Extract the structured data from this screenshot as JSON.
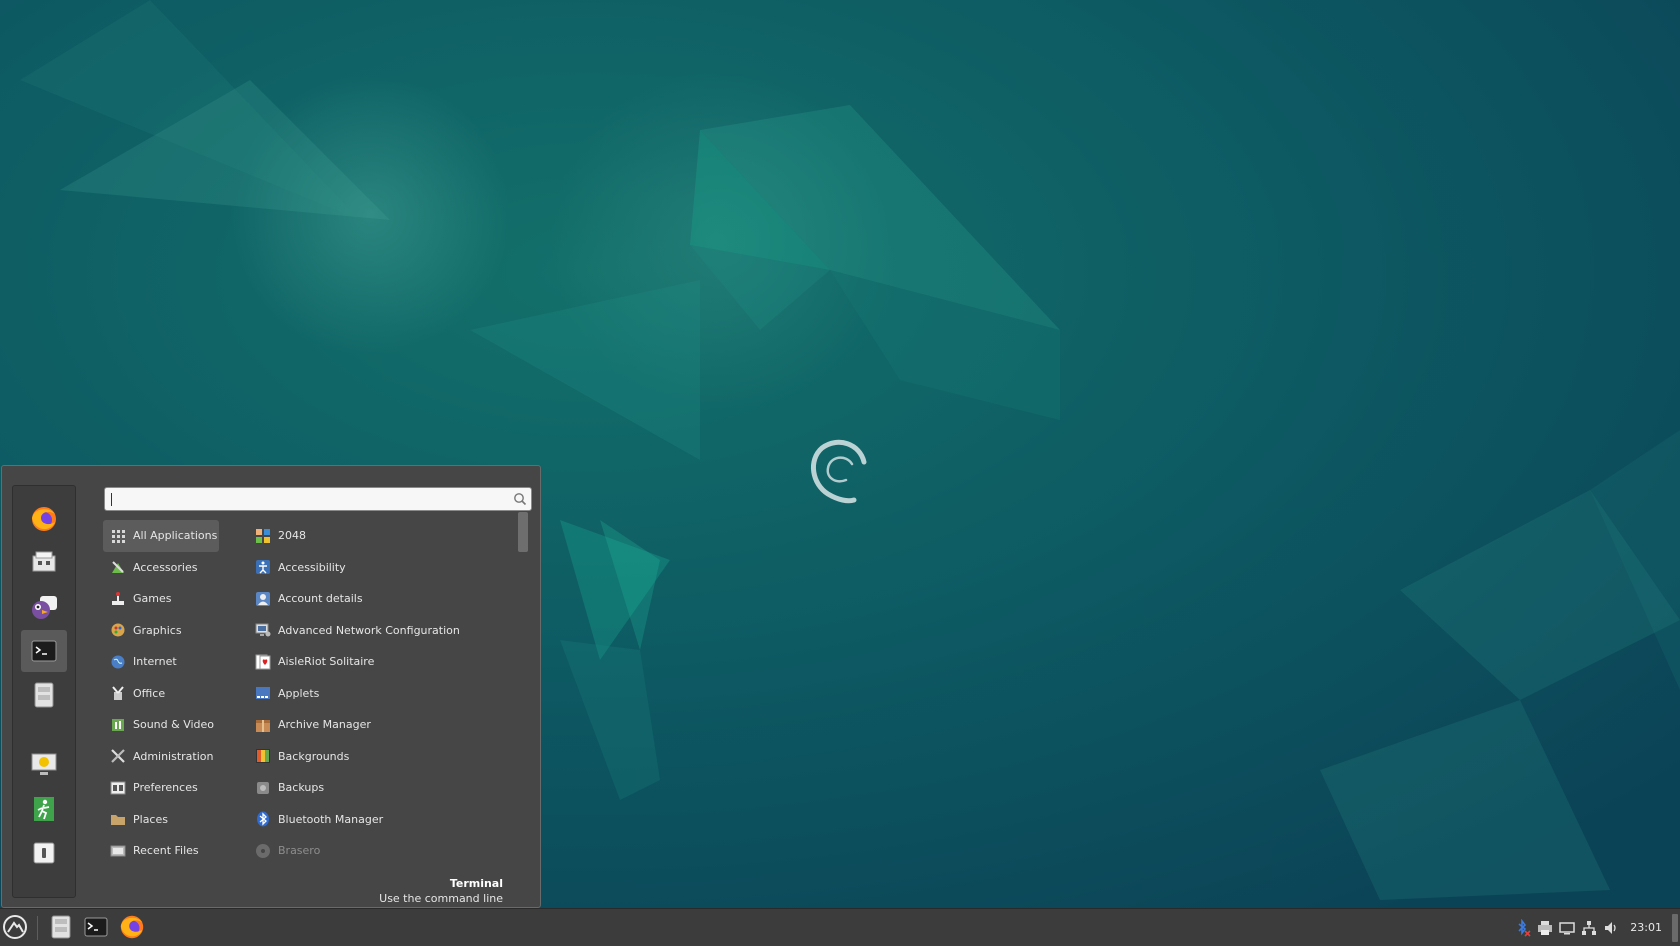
{
  "colors": {
    "accent": "#0d7c6e",
    "menu_bg": "#464646",
    "panel_bg": "#3c3c3c",
    "dim_text": "#8d8d8d"
  },
  "favorites": [
    {
      "icon": "firefox-icon"
    },
    {
      "icon": "software-manager-icon"
    },
    {
      "icon": "pidgin-icon"
    },
    {
      "icon": "terminal-icon",
      "active": true
    },
    {
      "icon": "file-manager-icon"
    },
    {
      "icon": "lock-screen-icon"
    },
    {
      "icon": "logout-icon"
    },
    {
      "icon": "shutdown-icon"
    }
  ],
  "search": {
    "placeholder": "",
    "value": ""
  },
  "categories": [
    {
      "label": "All Applications",
      "icon": "grid-icon"
    },
    {
      "label": "Accessories",
      "icon": "accessories-icon"
    },
    {
      "label": "Games",
      "icon": "games-icon"
    },
    {
      "label": "Graphics",
      "icon": "graphics-icon"
    },
    {
      "label": "Internet",
      "icon": "internet-icon"
    },
    {
      "label": "Office",
      "icon": "office-icon"
    },
    {
      "label": "Sound & Video",
      "icon": "sound-video-icon"
    },
    {
      "label": "Administration",
      "icon": "administration-icon"
    },
    {
      "label": "Preferences",
      "icon": "preferences-icon"
    },
    {
      "label": "Places",
      "icon": "folder-icon"
    },
    {
      "label": "Recent Files",
      "icon": "recent-files-icon"
    }
  ],
  "apps": [
    {
      "label": "2048",
      "icon": "game-2048-icon"
    },
    {
      "label": "Accessibility",
      "icon": "accessibility-icon"
    },
    {
      "label": "Account details",
      "icon": "account-icon"
    },
    {
      "label": "Advanced Network Configuration",
      "icon": "network-config-icon"
    },
    {
      "label": "AisleRiot Solitaire",
      "icon": "solitaire-icon"
    },
    {
      "label": "Applets",
      "icon": "applets-icon"
    },
    {
      "label": "Archive Manager",
      "icon": "archive-icon"
    },
    {
      "label": "Backgrounds",
      "icon": "backgrounds-icon"
    },
    {
      "label": "Backups",
      "icon": "backups-icon"
    },
    {
      "label": "Bluetooth Manager",
      "icon": "bluetooth-icon"
    },
    {
      "label": "Brasero",
      "icon": "brasero-icon",
      "dim": true
    }
  ],
  "info": {
    "title": "Terminal",
    "description": "Use the command line"
  },
  "panel": {
    "launchers": [
      "file-manager-icon",
      "terminal-icon",
      "firefox-icon"
    ],
    "tray": [
      "bluetooth-disabled-icon",
      "printer-icon",
      "display-icon",
      "network-icon",
      "volume-icon"
    ],
    "clock": "23:01"
  }
}
